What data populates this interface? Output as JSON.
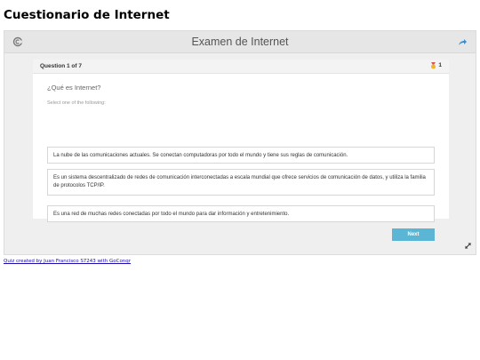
{
  "page": {
    "title": "Cuestionario de Internet",
    "footer_link": "Quiz created by Juan Francisco S7243 with GoConqr"
  },
  "widget": {
    "title": "Examen de Internet",
    "icons": {
      "logo": "goconqr-logo-icon",
      "share": "share-arrow-icon",
      "expand": "expand-arrows-icon",
      "medal": "medal-icon"
    }
  },
  "question": {
    "counter": "Question 1 of 7",
    "points": "1",
    "text": "¿Qué es Internet?",
    "instruction": "Select one of the following:",
    "options": [
      "La nube de las comunicaciones actuales. Se conectan computadoras por todo el mundo y tiene sus reglas de comunicación.",
      "Es un sistema descentralizado de redes de comunicación interconectadas a escala mundial que ofrece servicios de comunicación de datos, y utiliza la familia de protocolos TCP/IP.",
      "Es una red de muchas redes conectadas por todo el mundo para dar información y entretenimiento."
    ],
    "next_label": "Next"
  },
  "colors": {
    "accent": "#5bb6d6",
    "link": "#1a0dab",
    "widget_bg": "#efefef"
  }
}
